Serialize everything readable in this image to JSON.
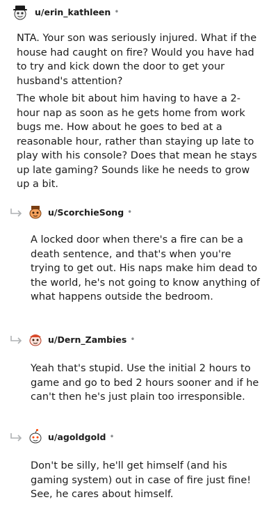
{
  "comments": [
    {
      "username": "u/erin_kathleen",
      "separator": "•",
      "avatar_icon": "snoo-avatar-hat-icon",
      "paragraphs": [
        "NTA. Your son was seriously injured. What if the house had caught on fire? Would you have had to try and kick down the door to get your husband's attention?",
        "The whole bit about him having to have a 2-hour nap as soon as he gets home from work bugs me. How about he goes to bed at a reasonable hour, rather than staying up late to play with his console? Does that mean he stays up late gaming? Sounds like he needs to grow up a bit."
      ]
    },
    {
      "username": "u/ScorchieSong",
      "separator": "•",
      "avatar_icon": "snoo-avatar-orange-icon",
      "reply_icon": "reply-arrow-icon",
      "paragraphs": [
        "A locked door when there's a fire can be a death sentence, and that's when you're trying to get out. His naps make him dead to the world, he's not going to know anything of what happens outside the bedroom."
      ]
    },
    {
      "username": "u/Dern_Zambies",
      "separator": "•",
      "avatar_icon": "snoo-avatar-red-icon",
      "reply_icon": "reply-arrow-icon",
      "paragraphs": [
        "Yeah that's stupid. Use the initial 2 hours to game and go to bed 2 hours sooner and if he can't then he's just plain too irresponsible."
      ]
    },
    {
      "username": "u/agoldgold",
      "separator": "•",
      "avatar_icon": "snoo-avatar-white-icon",
      "reply_icon": "reply-arrow-icon",
      "paragraphs": [
        "Don't be silly, he'll get himself (and his gaming system) out in case of fire just fine! See, he cares about himself."
      ]
    }
  ]
}
